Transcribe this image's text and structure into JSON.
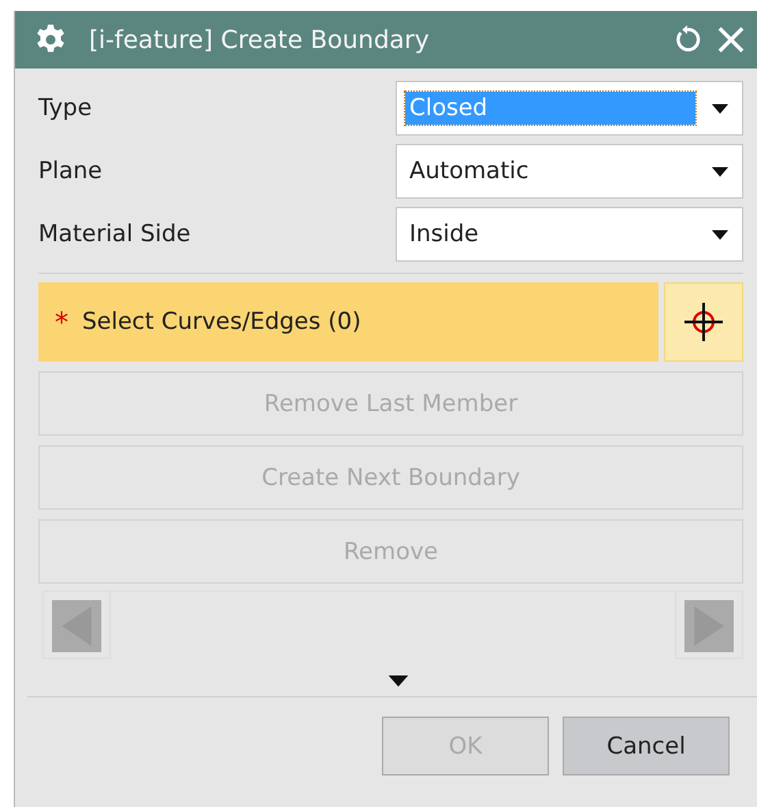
{
  "window": {
    "title": "[i-feature] Create Boundary"
  },
  "fields": [
    {
      "label": "Type",
      "value": "Closed",
      "focused": true
    },
    {
      "label": "Plane",
      "value": "Automatic",
      "focused": false
    },
    {
      "label": "Material Side",
      "value": "Inside",
      "focused": false
    }
  ],
  "selection": {
    "marker": "*",
    "label": "Select Curves/Edges (0)",
    "active": true
  },
  "actions": [
    {
      "label": "Remove Last Member",
      "disabled": true
    },
    {
      "label": "Create Next Boundary",
      "disabled": true
    },
    {
      "label": "Remove",
      "disabled": true
    }
  ],
  "navigation": {
    "disabled": true
  },
  "footer": [
    {
      "label": "OK",
      "disabled": true
    },
    {
      "label": "Cancel",
      "disabled": false
    }
  ]
}
